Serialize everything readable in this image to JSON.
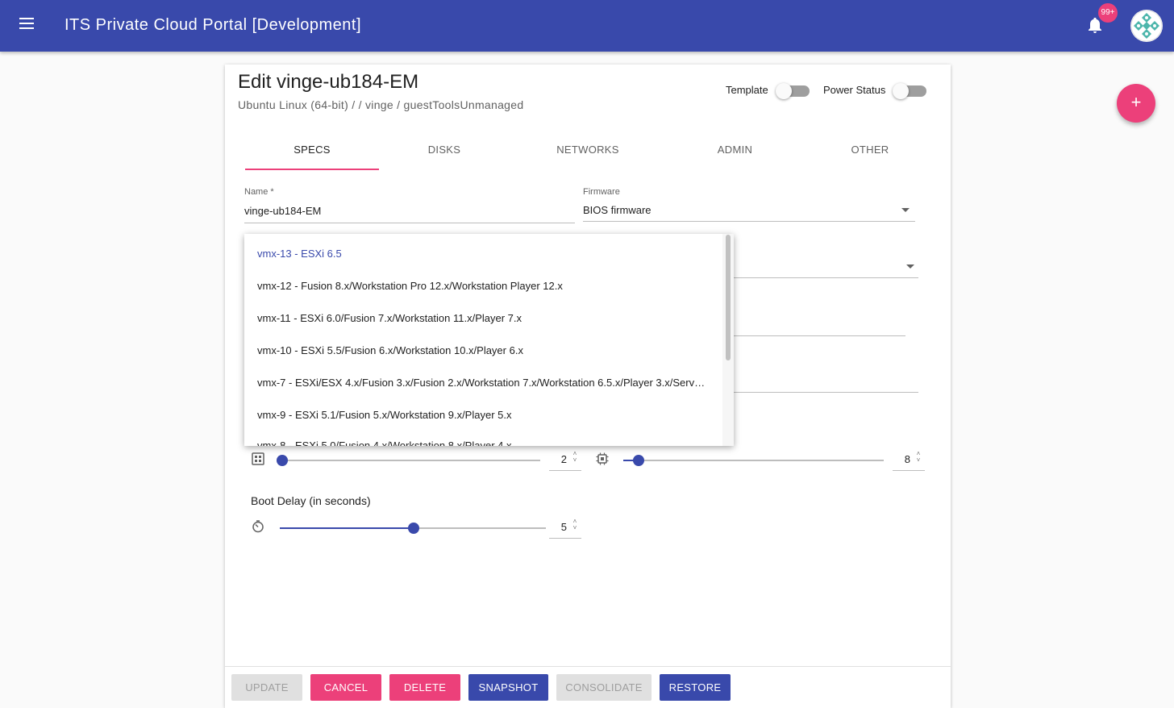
{
  "app": {
    "title": "ITS Private Cloud Portal [Development]",
    "notification_count": "99+"
  },
  "vm": {
    "title": "Edit vinge-ub184-EM",
    "subtitle": "Ubuntu Linux (64-bit) / / vinge / guestToolsUnmanaged"
  },
  "toggles": {
    "template_label": "Template",
    "template_on": false,
    "power_label": "Power Status",
    "power_on": false
  },
  "tabs": [
    {
      "label": "SPECS",
      "active": true
    },
    {
      "label": "DISKS",
      "active": false
    },
    {
      "label": "NETWORKS",
      "active": false
    },
    {
      "label": "ADMIN",
      "active": false
    },
    {
      "label": "OTHER",
      "active": false
    }
  ],
  "form": {
    "name_label": "Name *",
    "name_value": "vinge-ub184-EM",
    "firmware_label": "Firmware",
    "firmware_value": "BIOS firmware"
  },
  "hw_version_options": [
    {
      "label": "vmx-13 - ESXi 6.5",
      "selected": true
    },
    {
      "label": "vmx-12 - Fusion 8.x/Workstation Pro 12.x/Workstation Player 12.x",
      "selected": false
    },
    {
      "label": "vmx-11 - ESXi 6.0/Fusion 7.x/Workstation 11.x/Player 7.x",
      "selected": false
    },
    {
      "label": "vmx-10 - ESXi 5.5/Fusion 6.x/Workstation 10.x/Player 6.x",
      "selected": false
    },
    {
      "label": "vmx-7 - ESXi/ESX 4.x/Fusion 3.x/Fusion 2.x/Workstation 7.x/Workstation 6.5.x/Player 3.x/Serve...",
      "selected": false
    },
    {
      "label": "vmx-9 - ESXi 5.1/Fusion 5.x/Workstation 9.x/Player 5.x",
      "selected": false
    },
    {
      "label": "vmx-8 - ESXi 5.0/Fusion 4.x/Workstation 8.x/Player 4.x",
      "selected": false
    }
  ],
  "sliders": {
    "memory_value": "2",
    "memory_icon": "memory-icon",
    "cpu_value": "8",
    "cpu_icon": "cpu-chip-icon",
    "boot_delay_label": "Boot Delay (in seconds)",
    "boot_delay_value": "5",
    "boot_delay_icon": "timer-icon"
  },
  "buttons": {
    "update": "UPDATE",
    "cancel": "CANCEL",
    "delete": "DELETE",
    "snapshot": "SNAPSHOT",
    "consolidate": "CONSOLIDATE",
    "restore": "RESTORE"
  },
  "fab": {
    "label": "+"
  },
  "colors": {
    "primary": "#3949ab",
    "accent": "#ec407a"
  }
}
